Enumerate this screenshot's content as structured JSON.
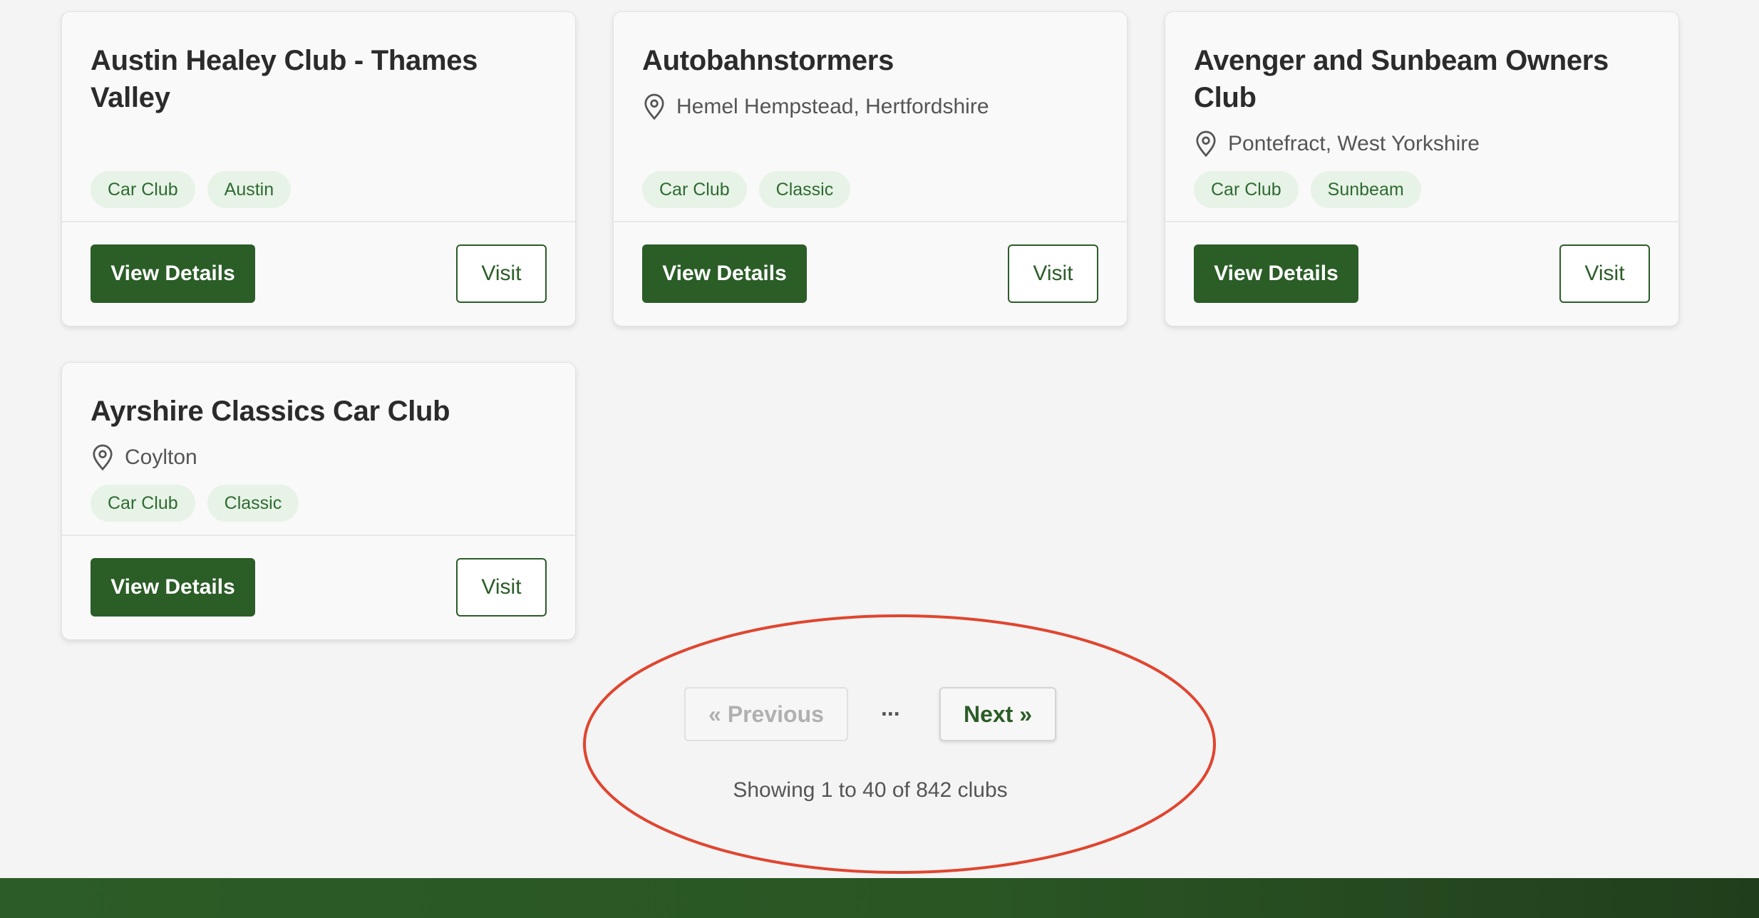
{
  "clubs": [
    {
      "name": "Austin Healey Club - Thames Valley",
      "location": "",
      "tags": [
        "Car Club",
        "Austin"
      ],
      "details_label": "View Details",
      "visit_label": "Visit"
    },
    {
      "name": "Autobahnstormers",
      "location": "Hemel Hempstead, Hertfordshire",
      "tags": [
        "Car Club",
        "Classic"
      ],
      "details_label": "View Details",
      "visit_label": "Visit"
    },
    {
      "name": "Avenger and Sunbeam Owners Club",
      "location": "Pontefract, West Yorkshire",
      "tags": [
        "Car Club",
        "Sunbeam"
      ],
      "details_label": "View Details",
      "visit_label": "Visit"
    },
    {
      "name": "Ayrshire Classics Car Club",
      "location": "Coylton",
      "tags": [
        "Car Club",
        "Classic"
      ],
      "details_label": "View Details",
      "visit_label": "Visit"
    }
  ],
  "pagination": {
    "previous_label": "« Previous",
    "ellipsis": "...",
    "next_label": "Next »",
    "summary": "Showing 1 to 40 of 842 clubs"
  },
  "colors": {
    "primary": "#2b5d27",
    "tag_bg": "#e7f3e6",
    "tag_text": "#2f6a32",
    "annotation": "#e0452f"
  },
  "icons": {
    "location": "map-pin-icon"
  }
}
